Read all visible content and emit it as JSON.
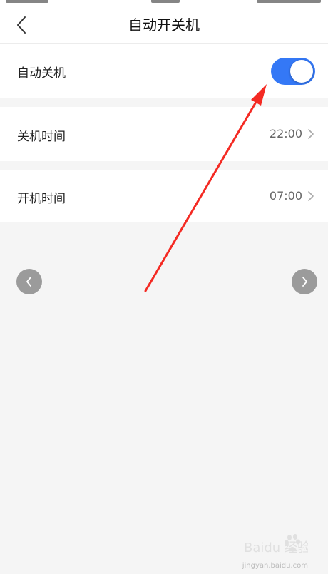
{
  "header": {
    "title": "自动开关机",
    "back_icon": "chevron-left-icon"
  },
  "settings": {
    "auto_shutdown": {
      "label": "自动关机",
      "enabled": true,
      "toggle_color": "#3478f6"
    },
    "shutdown_time": {
      "label": "关机时间",
      "value": "22:00"
    },
    "startup_time": {
      "label": "开机时间",
      "value": "07:00"
    }
  },
  "carousel": {
    "prev_icon": "chevron-left-icon",
    "next_icon": "chevron-right-icon"
  },
  "annotation": {
    "arrow_color": "#f42a23"
  },
  "watermark": {
    "text": "Baidu 经验",
    "subtext": "jingyan.baidu.com"
  }
}
